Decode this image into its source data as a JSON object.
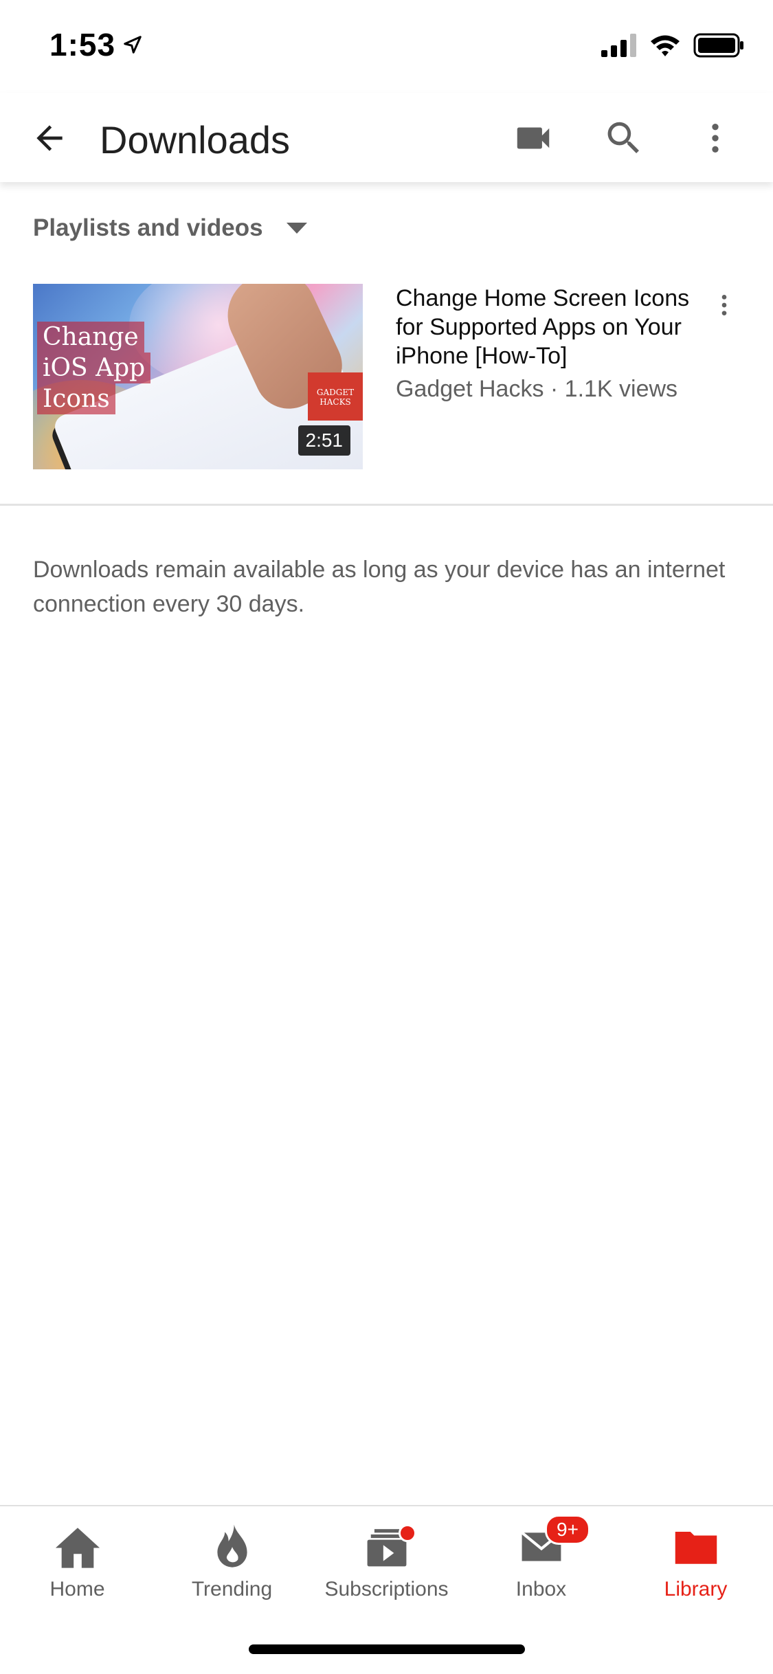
{
  "status_bar": {
    "time": "1:53"
  },
  "app_bar": {
    "title": "Downloads"
  },
  "filter": {
    "label": "Playlists and videos"
  },
  "video": {
    "thumbnail_caption": [
      "Change",
      "iOS App",
      "Icons"
    ],
    "brand_badge": [
      "GADGET",
      "HACKS"
    ],
    "duration": "2:51",
    "title": "Change Home Screen Icons for Supported Apps on Your iPhone [How-To]",
    "subtitle": "Gadget Hacks · 1.1K views"
  },
  "info_text": "Downloads remain available as long as your device has an internet connection every 30 days.",
  "bottom_nav": {
    "items": [
      {
        "label": "Home",
        "icon": "home-icon",
        "active": false
      },
      {
        "label": "Trending",
        "icon": "flame-icon",
        "active": false
      },
      {
        "label": "Subscriptions",
        "icon": "subscriptions-icon",
        "active": false
      },
      {
        "label": "Inbox",
        "icon": "inbox-icon",
        "active": false,
        "badge": "9+"
      },
      {
        "label": "Library",
        "icon": "folder-icon",
        "active": true
      }
    ]
  },
  "colors": {
    "accent": "#e62117",
    "secondary_text": "#606060",
    "primary_text": "#0f0f0f"
  }
}
